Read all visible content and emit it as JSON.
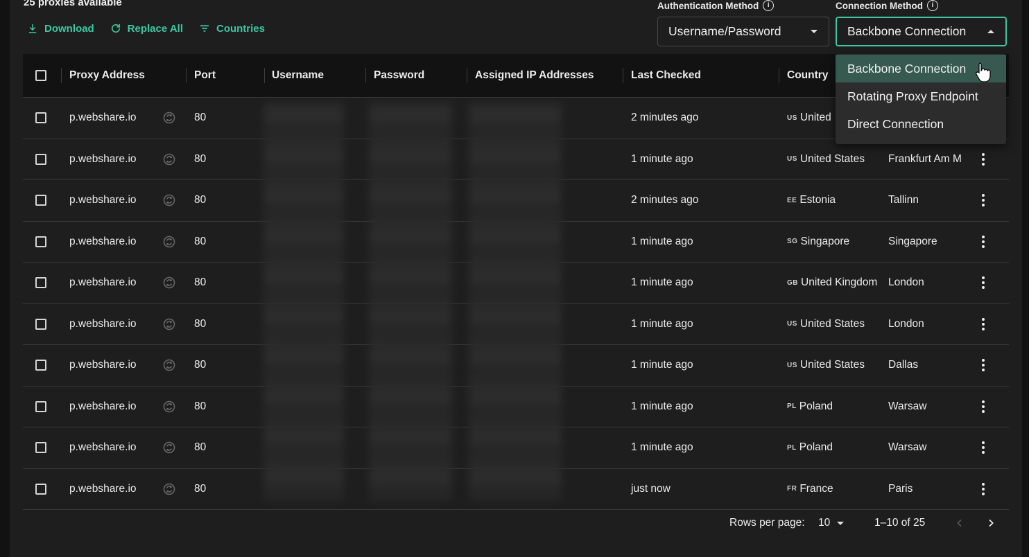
{
  "header": {
    "count_text": "25 proxies available",
    "download_label": "Download",
    "replace_all_label": "Replace All",
    "countries_label": "Countries"
  },
  "auth_method": {
    "label": "Authentication Method",
    "value": "Username/Password"
  },
  "connection_method": {
    "label": "Connection Method",
    "value": "Backbone Connection",
    "options": [
      "Backbone Connection",
      "Rotating Proxy Endpoint",
      "Direct Connection"
    ],
    "selected_index": 0
  },
  "table": {
    "columns": [
      "Proxy Address",
      "Port",
      "Username",
      "Password",
      "Assigned IP Addresses",
      "Last Checked",
      "Country"
    ],
    "rows": [
      {
        "address": "p.webshare.io",
        "port": "80",
        "last_checked": "2 minutes ago",
        "country_code": "US",
        "country": "United",
        "city": ""
      },
      {
        "address": "p.webshare.io",
        "port": "80",
        "last_checked": "1 minute ago",
        "country_code": "US",
        "country": "United States",
        "city": "Frankfurt Am M"
      },
      {
        "address": "p.webshare.io",
        "port": "80",
        "last_checked": "2 minutes ago",
        "country_code": "EE",
        "country": "Estonia",
        "city": "Tallinn"
      },
      {
        "address": "p.webshare.io",
        "port": "80",
        "last_checked": "1 minute ago",
        "country_code": "SG",
        "country": "Singapore",
        "city": "Singapore"
      },
      {
        "address": "p.webshare.io",
        "port": "80",
        "last_checked": "1 minute ago",
        "country_code": "GB",
        "country": "United Kingdom",
        "city": "London"
      },
      {
        "address": "p.webshare.io",
        "port": "80",
        "last_checked": "1 minute ago",
        "country_code": "US",
        "country": "United States",
        "city": "London"
      },
      {
        "address": "p.webshare.io",
        "port": "80",
        "last_checked": "1 minute ago",
        "country_code": "US",
        "country": "United States",
        "city": "Dallas"
      },
      {
        "address": "p.webshare.io",
        "port": "80",
        "last_checked": "1 minute ago",
        "country_code": "PL",
        "country": "Poland",
        "city": "Warsaw"
      },
      {
        "address": "p.webshare.io",
        "port": "80",
        "last_checked": "1 minute ago",
        "country_code": "PL",
        "country": "Poland",
        "city": "Warsaw"
      },
      {
        "address": "p.webshare.io",
        "port": "80",
        "last_checked": "just now",
        "country_code": "FR",
        "country": "France",
        "city": "Paris"
      }
    ]
  },
  "pagination": {
    "rows_per_page_label": "Rows per page:",
    "rows_per_page_value": "10",
    "range_text": "1–10 of 25"
  },
  "colors": {
    "accent": "#3ec6a0",
    "background": "#1e1e1e",
    "header_bg": "#121212",
    "menu_active": "#365a50"
  }
}
